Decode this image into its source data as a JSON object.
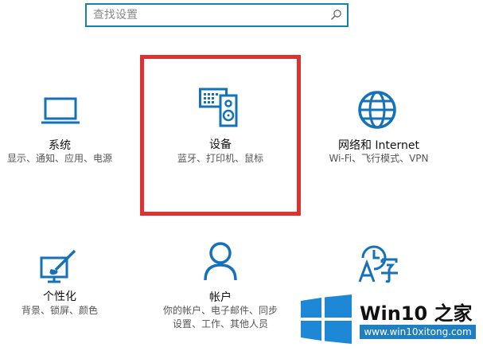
{
  "search": {
    "placeholder": "查找设置",
    "icon": "search-icon"
  },
  "tiles": [
    {
      "id": "system",
      "title": "系统",
      "desc": "显示、通知、应用、电源",
      "icon": "laptop-icon"
    },
    {
      "id": "devices",
      "title": "设备",
      "desc": "蓝牙、打印机、鼠标",
      "icon": "devices-icon",
      "highlighted": true
    },
    {
      "id": "network",
      "title": "网络和 Internet",
      "desc": "Wi-Fi、飞行模式、VPN",
      "icon": "globe-icon"
    },
    {
      "id": "personalization",
      "title": "个性化",
      "desc": "背景、锁屏、颜色",
      "icon": "paint-brush-icon"
    },
    {
      "id": "accounts",
      "title": "帐户",
      "desc_line1": "你的帐户、电子邮件、同步",
      "desc_line2": "设置、工作、其他人员",
      "icon": "person-icon"
    },
    {
      "id": "time-language",
      "icon": "time-language-icon"
    }
  ],
  "colors": {
    "accent": "#1672b8",
    "highlight": "#e03131",
    "search_border": "#1b7fa6"
  },
  "watermark": {
    "brand": "Win10 之家",
    "url": "www.win10xitong.com",
    "logo": "windows-logo-icon"
  }
}
